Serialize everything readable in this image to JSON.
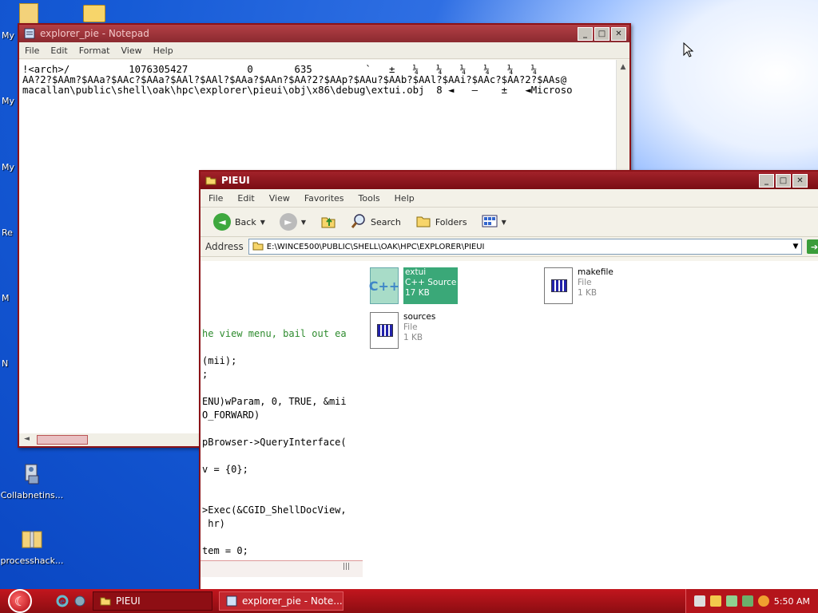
{
  "desktop": {
    "icons": [
      {
        "label": "Collabnetins..."
      },
      {
        "label": "processhack..."
      }
    ],
    "partial_labels": [
      "My I",
      "My",
      "My",
      "Re",
      "M",
      "N"
    ]
  },
  "notepad": {
    "title": "explorer_pie - Notepad",
    "menu": [
      "File",
      "Edit",
      "Format",
      "View",
      "Help"
    ],
    "lines": [
      "!<arch>/          1076305427          0       635         `   ±   ¼   ¼   ¼   ¼   ¼   ¼",
      "AA?2?$AAm?$AAa?$AAc?$AAa?$AAl?$AAl?$AAa?$AAn?$AA?2?$AAp?$AAu?$AAb?$AAl?$AAi?$AAc?$AA?2?$AAs@",
      "macallan\\public\\shell\\oak\\hpc\\explorer\\pieui\\obj\\x86\\debug\\extui.obj  8 ◄   –    ±   ◄Microso"
    ]
  },
  "explorer": {
    "title": "PIEUI",
    "menu": [
      "File",
      "Edit",
      "View",
      "Favorites",
      "Tools",
      "Help"
    ],
    "toolbar": {
      "back": "Back",
      "search": "Search",
      "folders": "Folders"
    },
    "address": {
      "label": "Address",
      "value": "E:\\WINCE500\\PUBLIC\\SHELL\\OAK\\HPC\\EXPLORER\\PIEUI",
      "go": "G"
    },
    "files": [
      {
        "name": "extui",
        "type": "C++ Source",
        "size": "17 KB",
        "selected": true
      },
      {
        "name": "makefile",
        "type": "File",
        "size": "1 KB",
        "selected": false
      },
      {
        "name": "sources",
        "type": "File",
        "size": "1 KB",
        "selected": false
      }
    ],
    "code_fragment": [
      {
        "text": "he view menu, bail out ea",
        "comment": true
      },
      {
        "text": "(mii);",
        "comment": false
      },
      {
        "text": ";",
        "comment": false
      },
      {
        "text": "ENU)wParam, 0, TRUE, &mii",
        "comment": false
      },
      {
        "text": "O_FORWARD)",
        "comment": false
      },
      {
        "text": "pBrowser->QueryInterface(",
        "comment": false
      },
      {
        "text": "v = {0};",
        "comment": false
      },
      {
        "text": ">Exec(&CGID_ShellDocView,",
        "comment": false
      },
      {
        "text": " hr)",
        "comment": false
      },
      {
        "text": "tem = 0;",
        "comment": false
      }
    ]
  },
  "taskbar": {
    "tasks": [
      {
        "label": "PIEUI",
        "active": true
      },
      {
        "label": "explorer_pie - Note...",
        "active": false
      }
    ],
    "clock": "5:50 AM"
  }
}
